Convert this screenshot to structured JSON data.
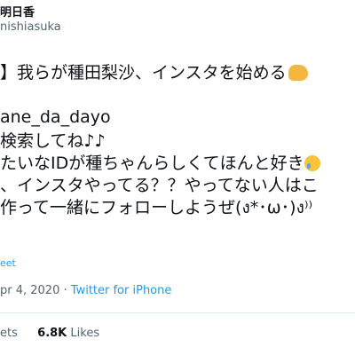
{
  "header": {
    "name": "明日香",
    "handle": "nishiasuka"
  },
  "tweet": {
    "lines": [
      "】我らが種田梨沙、インスタを始める",
      "ane_da_dayo",
      "検索してね♪♪",
      "たいなIDが種ちゃんらしくてほんと好き",
      "、インスタやってる？？やってない人はこ",
      "作って一緒にフォローしようぜ(ง*･ω･)ง⁾⁾"
    ],
    "translate_label": "eet"
  },
  "meta": {
    "date": "pr 4, 2020",
    "separator": "·",
    "source": "Twitter for iPhone"
  },
  "stats": {
    "partial": "ets",
    "likes_count": "6.8K",
    "likes_label": "Likes"
  },
  "colors": {
    "link": "#1d9bf0",
    "muted": "#536471",
    "text": "#0f1419"
  }
}
